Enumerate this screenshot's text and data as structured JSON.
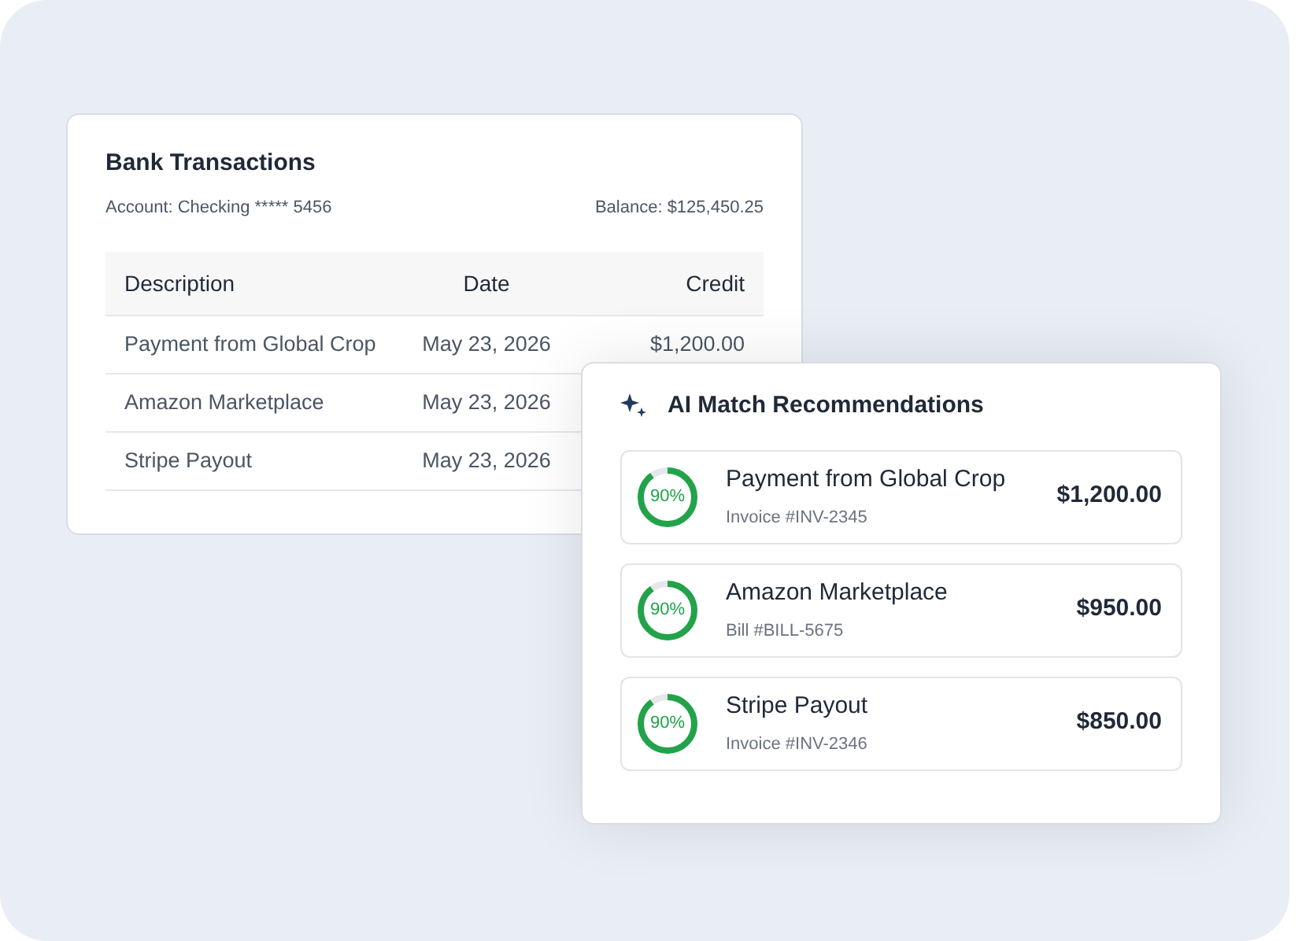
{
  "bank": {
    "title": "Bank Transactions",
    "account": "Account: Checking ***** 5456",
    "balance": "Balance: $125,450.25",
    "columns": [
      "Description",
      "Date",
      "Credit"
    ],
    "rows": [
      {
        "description": "Payment from Global Crop",
        "date": "May 23, 2026",
        "credit": "$1,200.00"
      },
      {
        "description": "Amazon Marketplace",
        "date": "May 23, 2026"
      },
      {
        "description": "Stripe Payout",
        "date": "May 23, 2026"
      }
    ]
  },
  "matches": {
    "title": "AI Match Recommendations",
    "items": [
      {
        "level": 0.9,
        "reading": "90%",
        "name": "Payment from Global Crop",
        "reference": "Invoice #INV-2345",
        "amount": "$1,200.00"
      },
      {
        "level": 0.9,
        "reading": "90%",
        "name": "Amazon Marketplace",
        "reference": "Bill #BILL-5675",
        "amount": "$950.00"
      },
      {
        "level": 0.9,
        "reading": "90%",
        "name": "Stripe Payout",
        "reference": "Invoice #INV-2346",
        "amount": "$850.00"
      }
    ]
  }
}
